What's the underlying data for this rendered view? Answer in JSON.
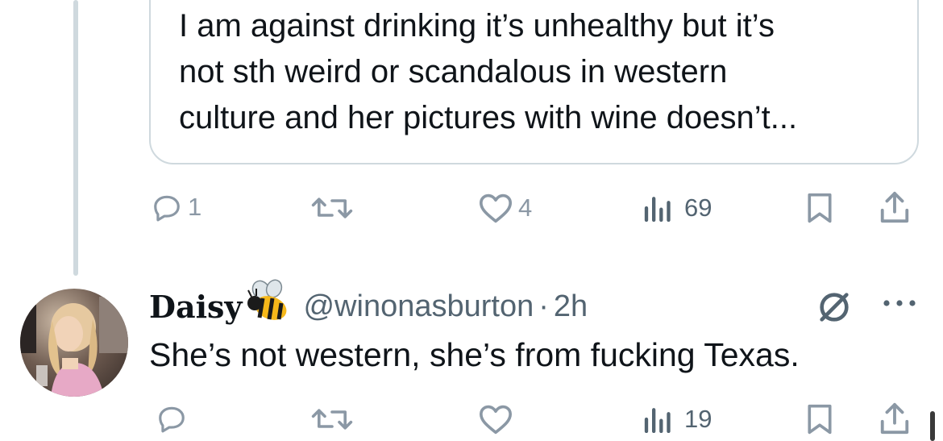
{
  "quoted_tweet": {
    "lines": [
      "I am against drinking it’s unhealthy but it’s",
      "not sth weird or scandalous in western",
      "culture and her pictures with wine doesn’t..."
    ]
  },
  "quoted_actions": {
    "reply_count": "1",
    "like_count": "4",
    "views_count": "69"
  },
  "reply": {
    "display_name": "Daisy",
    "name_emoji": "bee-emoji",
    "handle": "@winonasburton",
    "separator": "·",
    "time": "2h",
    "text": "She’s not western, she’s from fucking Texas."
  },
  "reply_actions": {
    "views_count": "19"
  },
  "icons": {
    "reply": "reply-icon",
    "retweet": "retweet-icon",
    "like": "like-icon",
    "views": "views-icon",
    "bookmark": "bookmark-icon",
    "share": "share-icon",
    "grok": "grok-icon",
    "more": "more-icon"
  },
  "colors": {
    "text": "#0f1419",
    "secondary": "#536471",
    "icon_gray": "#8b98a5",
    "border": "#cfd9de"
  }
}
